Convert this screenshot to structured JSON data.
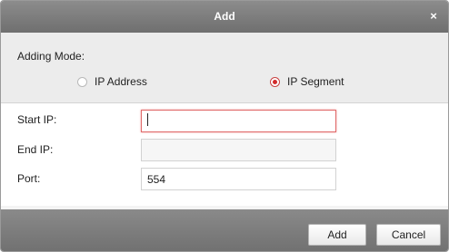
{
  "dialog": {
    "title": "Add",
    "close_glyph": "×"
  },
  "mode": {
    "label": "Adding Mode:",
    "options": [
      {
        "label": "IP Address",
        "selected": false
      },
      {
        "label": "IP Segment",
        "selected": true
      }
    ]
  },
  "fields": {
    "start_ip": {
      "label": "Start IP:",
      "value": ""
    },
    "end_ip": {
      "label": "End IP:",
      "value": ""
    },
    "port": {
      "label": "Port:",
      "value": "554"
    }
  },
  "buttons": {
    "add": "Add",
    "cancel": "Cancel"
  },
  "colors": {
    "titlebar": "#7d7d7d",
    "selected_radio": "#d22b2b",
    "focus_border": "#e06a6a"
  }
}
